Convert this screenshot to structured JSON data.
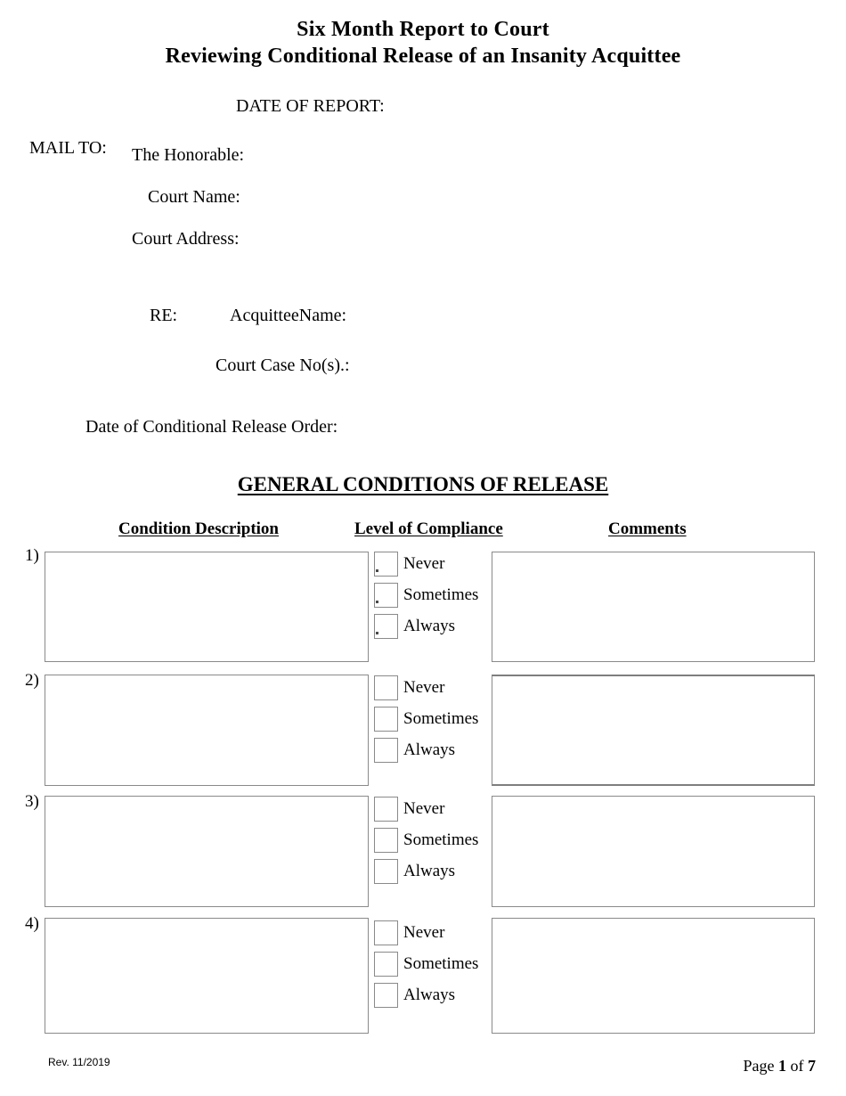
{
  "document": {
    "title_line_1": "Six Month Report to Court",
    "title_line_2": "Reviewing Conditional Release of an Insanity Acquittee"
  },
  "header": {
    "date_of_report_label": "DATE OF REPORT:",
    "mail_to_label": "MAIL TO:",
    "honorable_label": "The Honorable:",
    "court_name_label": "Court Name:",
    "court_address_label": "Court Address:",
    "re_label": "RE:",
    "acquittee_name_label": "AcquitteeName:",
    "court_case_no_label": "Court Case No(s).:",
    "date_of_conditional_release_order_label": "Date of Conditional Release Order:"
  },
  "section": {
    "heading": "GENERAL CONDITIONS OF RELEASE",
    "columns": {
      "condition_description": "Condition Description",
      "level_of_compliance": "Level of Compliance",
      "comments": "Comments"
    },
    "compliance_options": [
      "Never",
      "Sometimes",
      "Always"
    ],
    "rows": [
      {
        "number": "1)",
        "condition_text": "",
        "comments_text": "",
        "selected_compliance": ""
      },
      {
        "number": "2)",
        "condition_text": "",
        "comments_text": "",
        "selected_compliance": ""
      },
      {
        "number": "3)",
        "condition_text": "",
        "comments_text": "",
        "selected_compliance": ""
      },
      {
        "number": "4)",
        "condition_text": "",
        "comments_text": "",
        "selected_compliance": ""
      }
    ]
  },
  "footer": {
    "revision": "Rev. 11/2019",
    "page_prefix": "Page ",
    "page_current": "1",
    "page_middle": " of ",
    "page_total": "7"
  },
  "style": {
    "box_border_color": "#8a8a8a",
    "text_color": "#000000",
    "page_background": "#ffffff"
  }
}
